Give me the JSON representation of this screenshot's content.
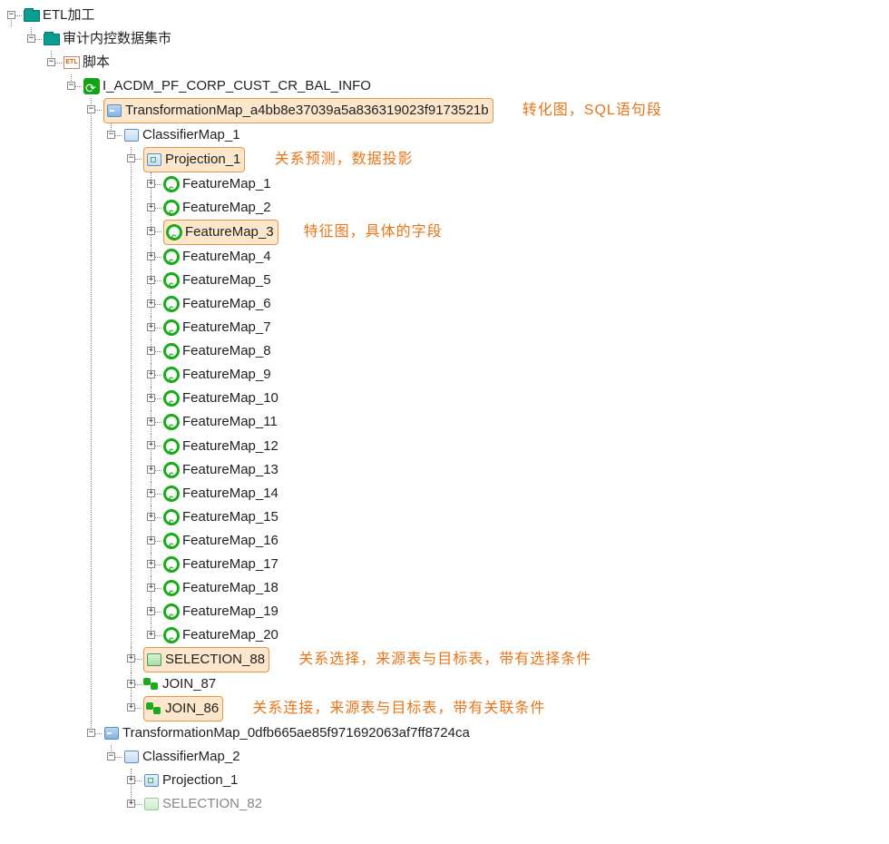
{
  "root": {
    "label": "ETL加工",
    "child": {
      "label": "审计内控数据集市",
      "child": {
        "label": "脚本",
        "child": {
          "label": "I_ACDM_PF_CORP_CUST_CR_BAL_INFO",
          "maps": [
            {
              "label": "TransformationMap_a4bb8e37039a5a836319023f9173521b",
              "annotation": "转化图，SQL语句段",
              "classifier": {
                "label": "ClassifierMap_1",
                "projection": {
                  "label": "Projection_1",
                  "annotation": "关系预测，数据投影",
                  "features": [
                    "FeatureMap_1",
                    "FeatureMap_2",
                    "FeatureMap_3",
                    "FeatureMap_4",
                    "FeatureMap_5",
                    "FeatureMap_6",
                    "FeatureMap_7",
                    "FeatureMap_8",
                    "FeatureMap_9",
                    "FeatureMap_10",
                    "FeatureMap_11",
                    "FeatureMap_12",
                    "FeatureMap_13",
                    "FeatureMap_14",
                    "FeatureMap_15",
                    "FeatureMap_16",
                    "FeatureMap_17",
                    "FeatureMap_18",
                    "FeatureMap_19",
                    "FeatureMap_20"
                  ],
                  "feature_hl_index": 2,
                  "feature_annotation": "特征图，具体的字段"
                },
                "selection": {
                  "label": "SELECTION_88",
                  "annotation": "关系选择，来源表与目标表，带有选择条件"
                },
                "joins": [
                  {
                    "label": "JOIN_87"
                  },
                  {
                    "label": "JOIN_86",
                    "annotation": "关系连接，来源表与目标表，带有关联条件"
                  }
                ]
              }
            },
            {
              "label": "TransformationMap_0dfb665ae85f971692063af7ff8724ca",
              "classifier": {
                "label": "ClassifierMap_2",
                "projection": {
                  "label": "Projection_1"
                },
                "selection_partial": "SELECTION_82"
              }
            }
          ]
        }
      }
    }
  }
}
